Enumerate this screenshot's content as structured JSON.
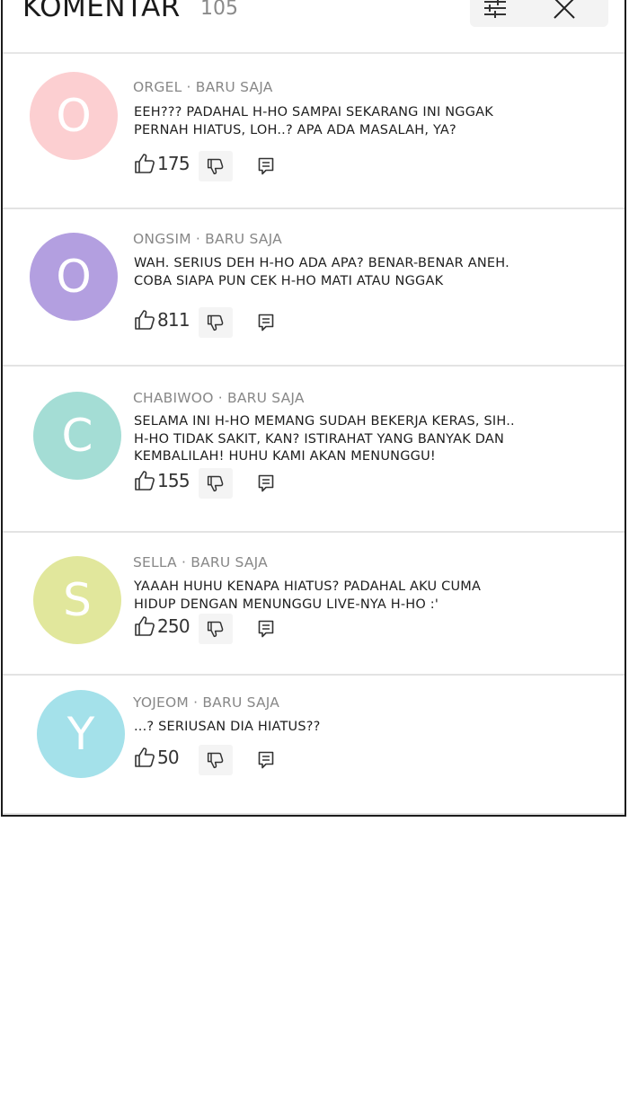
{
  "header": {
    "title": "KOMENTAR",
    "count": "105"
  },
  "icons": {
    "filter": "sliders-icon",
    "close": "close-icon",
    "like": "thumbs-up-icon",
    "dislike": "thumbs-down-icon",
    "reply": "reply-icon"
  },
  "comments": [
    {
      "avatar_letter": "O",
      "avatar_color": "#fccfd1",
      "meta": "ORGEL · BARU SAJA",
      "text_lines": [
        "EEH??? PADAHAL H-HO SAMPAI SEKARANG INI NGGAK",
        "PERNAH HIATUS, LOH..? APA ADA MASALAH, YA?"
      ],
      "likes": "175"
    },
    {
      "avatar_letter": "O",
      "avatar_color": "#b39fe0",
      "meta": "ONGSIM · BARU SAJA",
      "text_lines": [
        "WAH. SERIUS DEH H-HO ADA APA? BENAR-BENAR ANEH.",
        "COBA SIAPA PUN CEK H-HO MATI ATAU NGGAK"
      ],
      "likes": "811"
    },
    {
      "avatar_letter": "C",
      "avatar_color": "#a4ddd5",
      "meta": "CHABIWOO · BARU SAJA",
      "text_lines": [
        "SELAMA INI H-HO MEMANG SUDAH BEKERJA KERAS, SIH..",
        "H-HO TIDAK SAKIT, KAN? ISTIRAHAT YANG BANYAK DAN",
        "KEMBALILAH! HUHU KAMI AKAN MENUNGGU!"
      ],
      "likes": "155"
    },
    {
      "avatar_letter": "S",
      "avatar_color": "#e1e79c",
      "meta": "SELLA · BARU SAJA",
      "text_lines": [
        "YAAAH HUHU KENAPA HIATUS? PADAHAL AKU CUMA",
        "HIDUP DENGAN MENUNGGU LIVE-NYA H-HO :'"
      ],
      "likes": "250"
    },
    {
      "avatar_letter": "Y",
      "avatar_color": "#a4e1ea",
      "meta": "YOJEOM · BARU SAJA",
      "text_lines": [
        "...? SERIUSAN DIA HIATUS??"
      ],
      "likes": "50"
    }
  ]
}
